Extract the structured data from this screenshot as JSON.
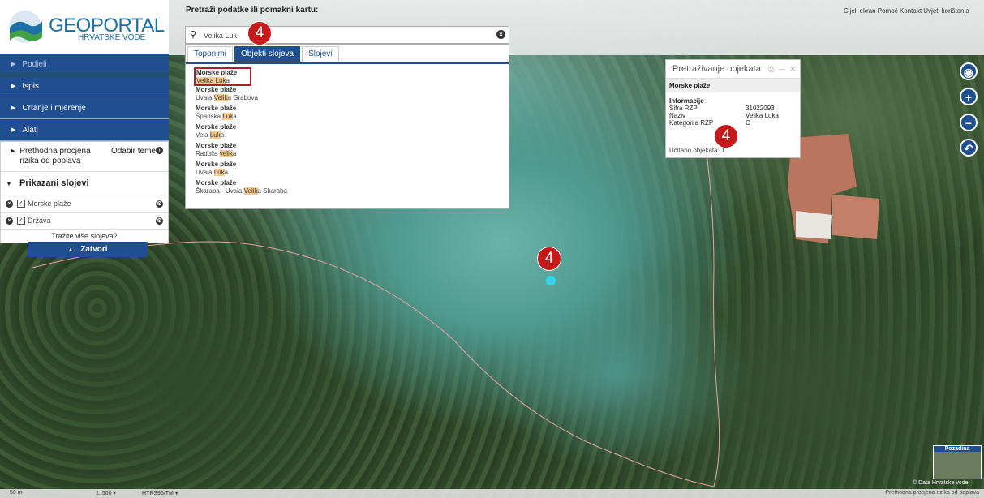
{
  "app": {
    "logo_title": "GEOPORTAL",
    "logo_subtitle": "HRVATSKE VODE"
  },
  "header": {
    "top_links": "Cijeli ekran Pomoć Kontakt Uvjeti korištenja"
  },
  "sidebar": {
    "items": [
      {
        "label": "Podjeli"
      },
      {
        "label": "Ispis"
      },
      {
        "label": "Crtanje i mjerenje"
      },
      {
        "label": "Alati"
      }
    ],
    "previous_assessment": "Prethodna procjena rizika od poplava",
    "choose_theme": "Odabir teme",
    "layers_title": "Prikazani slojevi",
    "layers": [
      {
        "name": "Morske plaže",
        "checked": true
      },
      {
        "name": "Država",
        "checked": true
      }
    ],
    "more_layers": "Tražite više slojeva?",
    "close_label": "Zatvori"
  },
  "search": {
    "label": "Pretraži podatke ili pomakni kartu:",
    "value": "Velika Luk",
    "tabs": [
      {
        "label": "Toponimi",
        "active": false
      },
      {
        "label": "Objekti slojeva",
        "active": true
      },
      {
        "label": "Slojevi",
        "active": false
      }
    ],
    "results": [
      {
        "category": "Morske plaže",
        "pre": "",
        "match": "Velika Luk",
        "post": "a",
        "selected": true
      },
      {
        "category": "Morske plaže",
        "pre": "Uvala ",
        "match": "Velik",
        "post": "a Grabova",
        "selected": false
      },
      {
        "category": "Morske plaže",
        "pre": "Španska ",
        "match": "Luk",
        "post": "a",
        "selected": false
      },
      {
        "category": "Morske plaže",
        "pre": "Vela ",
        "match": "Luk",
        "post": "a",
        "selected": false
      },
      {
        "category": "Morske plaže",
        "pre": "Raduča ",
        "match": "velik",
        "post": "a",
        "selected": false
      },
      {
        "category": "Morske plaže",
        "pre": "Uvala ",
        "match": "Luk",
        "post": "a",
        "selected": false
      },
      {
        "category": "Morske plaže",
        "pre": "Škaraba - Uvala ",
        "match": "Velik",
        "post": "a Skaraba",
        "selected": false
      }
    ]
  },
  "popup": {
    "title": "Pretraživanje objekata",
    "subtitle": "Morske plaže",
    "info_heading": "Informacije",
    "rows": [
      {
        "key": "Šifra RZP",
        "value": "31022093"
      },
      {
        "key": "Naziv",
        "value": "Velika Luka"
      },
      {
        "key": "Kategorija RZP",
        "value": "C"
      }
    ],
    "footer": "Učitano objekata: 1"
  },
  "badges": [
    "4",
    "4",
    "4"
  ],
  "bottom": {
    "scale": "50 m",
    "zoom": "1: 500",
    "projection": "HTRS96/TM",
    "footnote": "Prethodna procjena rizika od poplava",
    "background_label": "Pozadina",
    "credit": "© Data Hrvatske vode"
  },
  "colors": {
    "brand_blue": "#1f4e91",
    "badge_red": "#c41a1a",
    "highlight": "#f5c98a"
  }
}
